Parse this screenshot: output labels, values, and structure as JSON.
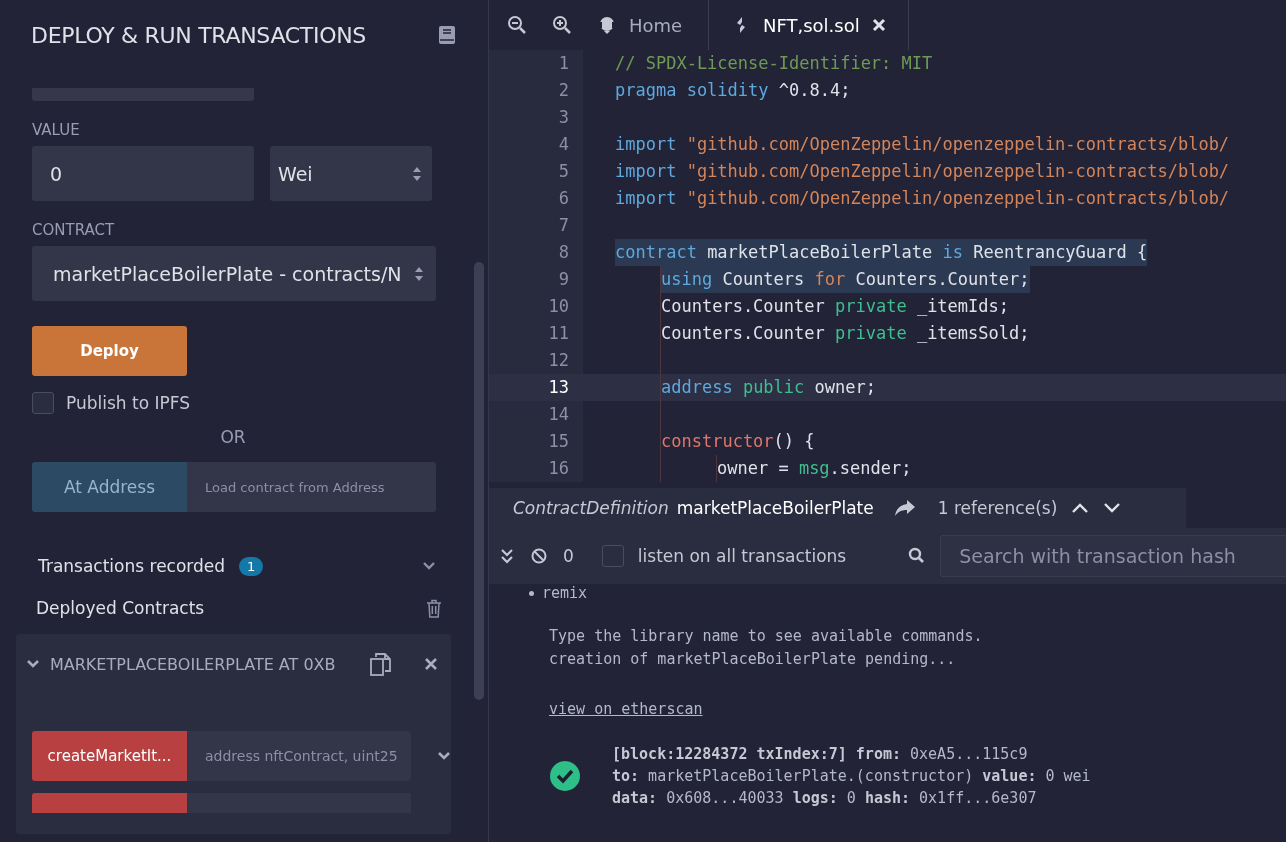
{
  "side_panel": {
    "title": "DEPLOY & RUN TRANSACTIONS",
    "value_label": "VALUE",
    "value": "0",
    "unit": "Wei",
    "contract_label": "CONTRACT",
    "contract": "marketPlaceBoilerPlate - contracts/N",
    "deploy_button": "Deploy",
    "publish": {
      "label": "Publish to IPFS",
      "checked": false
    },
    "or_label": "OR",
    "at_address_button": "At Address",
    "address_placeholder": "Load contract from Address",
    "transactions": {
      "label": "Transactions recorded",
      "count": "1"
    },
    "deployed_label": "Deployed Contracts",
    "instance": {
      "title": "MARKETPLACEBOILERPLATE AT 0XB",
      "expanded": true,
      "functions": [
        {
          "name": "createMarketIt...",
          "placeholder": "address nftContract, uint25"
        }
      ]
    }
  },
  "editor": {
    "tabs": [
      {
        "label": "Home",
        "kind": "home",
        "selected": false
      },
      {
        "label": "NFT,sol.sol",
        "kind": "file",
        "selected": true
      }
    ],
    "lines": [
      {
        "number": "1",
        "kind": "top",
        "highlighted": false,
        "active": false,
        "tokens": [
          {
            "kind": "comment",
            "text": "// SPDX-License-Identifier: MIT"
          }
        ]
      },
      {
        "number": "2",
        "kind": "top",
        "highlighted": false,
        "active": false,
        "tokens": [
          {
            "kind": "keyword",
            "text": "pragma solidity"
          },
          {
            "kind": "plain",
            "text": " ^0.8.4;"
          }
        ]
      },
      {
        "number": "3",
        "kind": "top",
        "highlighted": false,
        "active": false
      },
      {
        "number": "4",
        "kind": "top",
        "highlighted": false,
        "active": false,
        "tokens": [
          {
            "kind": "keyword",
            "text": "import"
          },
          {
            "kind": "string",
            "text": " \"github.com/OpenZeppelin/openzeppelin-contracts/blob/"
          }
        ]
      },
      {
        "number": "5",
        "kind": "top",
        "highlighted": false,
        "active": false,
        "tokens": [
          {
            "kind": "keyword",
            "text": "import"
          },
          {
            "kind": "string",
            "text": " \"github.com/OpenZeppelin/openzeppelin-contracts/blob/"
          }
        ]
      },
      {
        "number": "6",
        "kind": "top",
        "highlighted": false,
        "active": false,
        "tokens": [
          {
            "kind": "keyword",
            "text": "import"
          },
          {
            "kind": "string",
            "text": " \"github.com/OpenZeppelin/openzeppelin-contracts/blob/"
          }
        ]
      },
      {
        "number": "7",
        "kind": "top",
        "highlighted": false,
        "active": false
      },
      {
        "number": "8",
        "kind": "top",
        "highlighted": true,
        "active": false,
        "tokens": [
          {
            "kind": "keyword",
            "text": "contract"
          },
          {
            "kind": "plain",
            "text": " marketPlaceBoilerPlate "
          },
          {
            "kind": "keyword",
            "text": "is"
          },
          {
            "kind": "plain",
            "text": " ReentrancyGuard {"
          }
        ]
      },
      {
        "number": "9",
        "kind": "member",
        "highlighted": true,
        "active": false,
        "tokens": [
          {
            "kind": "keyword",
            "text": "using"
          },
          {
            "kind": "plain",
            "text": " Counters "
          },
          {
            "kind": "string",
            "text": "for"
          },
          {
            "kind": "plain",
            "text": " Counters.Counter;"
          }
        ]
      },
      {
        "number": "10",
        "kind": "member",
        "highlighted": false,
        "active": false,
        "tokens": [
          {
            "kind": "plain",
            "text": "Counters.Counter "
          },
          {
            "kind": "modifier",
            "text": "private"
          },
          {
            "kind": "plain",
            "text": " _itemIds;"
          }
        ]
      },
      {
        "number": "11",
        "kind": "member",
        "highlighted": false,
        "active": false,
        "tokens": [
          {
            "kind": "plain",
            "text": "Counters.Counter "
          },
          {
            "kind": "modifier",
            "text": "private"
          },
          {
            "kind": "plain",
            "text": " _itemsSold;"
          }
        ]
      },
      {
        "number": "12",
        "kind": "member",
        "highlighted": false,
        "active": false
      },
      {
        "number": "13",
        "kind": "member",
        "highlighted": false,
        "active": true,
        "tokens": [
          {
            "kind": "keyword",
            "text": "address"
          },
          {
            "kind": "modifier",
            "text": " public"
          },
          {
            "kind": "plain",
            "text": " owner;"
          }
        ]
      },
      {
        "number": "14",
        "kind": "member",
        "highlighted": false,
        "active": false
      },
      {
        "number": "15",
        "kind": "member",
        "highlighted": false,
        "active": false,
        "tokens": [
          {
            "kind": "function",
            "text": "constructor"
          },
          {
            "kind": "plain",
            "text": "() {"
          }
        ]
      },
      {
        "number": "16",
        "kind": "nested",
        "highlighted": false,
        "active": false,
        "tokens": [
          {
            "kind": "plain",
            "text": "owner = "
          },
          {
            "kind": "modifier",
            "text": "msg"
          },
          {
            "kind": "plain",
            "text": ".sender;"
          }
        ]
      }
    ],
    "reference_bar": {
      "kind_label": "ContractDefinition",
      "name": "marketPlaceBoilerPlate",
      "references": "1 reference(s)"
    }
  },
  "terminal": {
    "pending_count": "0",
    "listen": {
      "label": "listen on all transactions",
      "checked": false
    },
    "search_placeholder": "Search with transaction hash",
    "bullet": "remix",
    "messages": [
      "Type the library name to see available commands.",
      "creation of marketPlaceBoilerPlate pending..."
    ],
    "link": "view on etherscan",
    "transaction": {
      "success": true,
      "lines": [
        "**[block:12284372 txIndex:7]  from:** 0xeA5...115c9",
        "**to:** marketPlaceBoilerPlate.(constructor) **value:** 0 wei",
        "**data:** 0x608...40033 **logs:** 0 **hash:** 0x1ff...6e307"
      ]
    }
  }
}
